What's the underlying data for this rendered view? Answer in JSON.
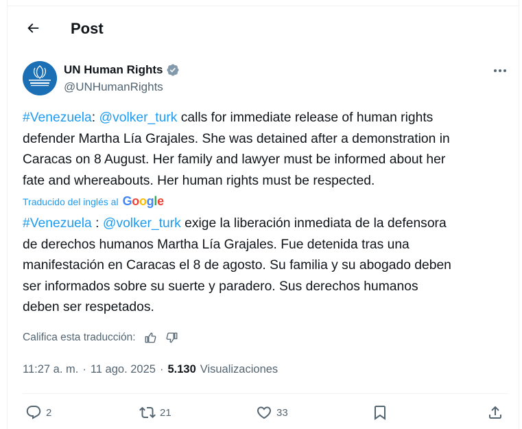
{
  "header": {
    "title": "Post"
  },
  "author": {
    "name": "UN Human Rights",
    "handle": "@UNHumanRights",
    "avatar_text": "UNITED NATIONS HUMAN RIGHTS",
    "verified": true
  },
  "tweet_en": {
    "line1": {
      "hashtag": "#Venezuela",
      "sep": ": ",
      "mention": "@volker_turk",
      "rest": " calls for immediate release of human rights"
    },
    "line2": "defender Martha Lía Grajales. She was detained after a demonstration in",
    "line3": "Caracas on 8 August. Her family and lawyer must be informed about her",
    "line4": "fate and whereabouts. Her human rights must be respected."
  },
  "translation": {
    "label": "Traducido del inglés al",
    "provider": "Google"
  },
  "tweet_es": {
    "line1": {
      "hashtag": "#Venezuela",
      "sep": " : ",
      "mention": "@volker_turk",
      "rest": " exige la liberación inmediata de la defensora"
    },
    "line2": "de derechos humanos Martha Lía Grajales. Fue detenida tras una",
    "line3": "manifestación en Caracas el 8 de agosto. Su familia y su abogado deben",
    "line4": "ser informados sobre su suerte y paradero. Sus derechos humanos",
    "line5": "deben ser respetados."
  },
  "rate": {
    "label": "Califica esta traducción:"
  },
  "meta": {
    "time": "11:27 a. m.",
    "dot1": "·",
    "date": "11 ago. 2025",
    "dot2": "·",
    "views": "5.130",
    "views_label": "Visualizaciones"
  },
  "actions": {
    "replies": "2",
    "reposts": "21",
    "likes": "33"
  },
  "colors": {
    "link": "#1d9bf0",
    "muted": "#536471",
    "text": "#0f1419",
    "verified": "#829aab"
  }
}
